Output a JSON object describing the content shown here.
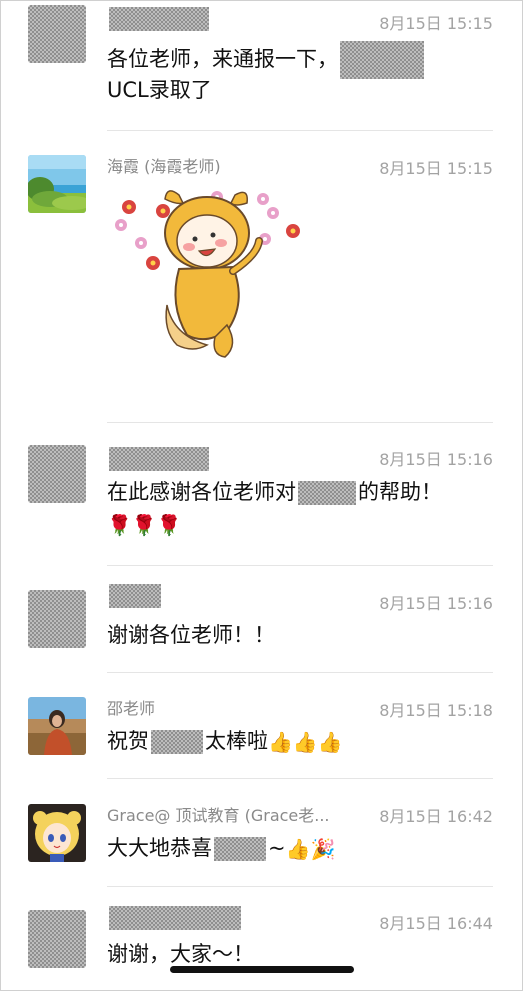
{
  "messages": [
    {
      "name": "",
      "time": "8月15日 15:15",
      "line1": "各位老师，来通报一下，",
      "line2": "UCL录取了"
    },
    {
      "name": "海霞 (海霞老师)",
      "time": "8月15日 15:15",
      "sticker": "flower-throwing-character-sticker"
    },
    {
      "name": "",
      "time": "8月15日 15:16",
      "line1_a": "在此感谢各位老师对",
      "line1_b": "的帮助！",
      "line2_emoji": "🌹🌹🌹"
    },
    {
      "name": "",
      "time": "8月15日 15:16",
      "line1": "谢谢各位老师！！"
    },
    {
      "name": "邵老师",
      "time": "8月15日 15:18",
      "line1_a": "祝贺",
      "line1_b": "太棒啦",
      "emoji": "👍👍👍"
    },
    {
      "name": "Grace@ 顶试教育 (Grace老...",
      "time": "8月15日 16:42",
      "line1_a": "大大地恭喜",
      "line1_b": "~",
      "emoji": "👍🎉"
    },
    {
      "name": "",
      "time": "8月15日 16:44",
      "line1": "谢谢，大家～！"
    }
  ],
  "colors": {
    "name": "#8a8a8a",
    "time": "#a3a3a3",
    "text": "#111111",
    "divider": "#e5e5e5"
  }
}
